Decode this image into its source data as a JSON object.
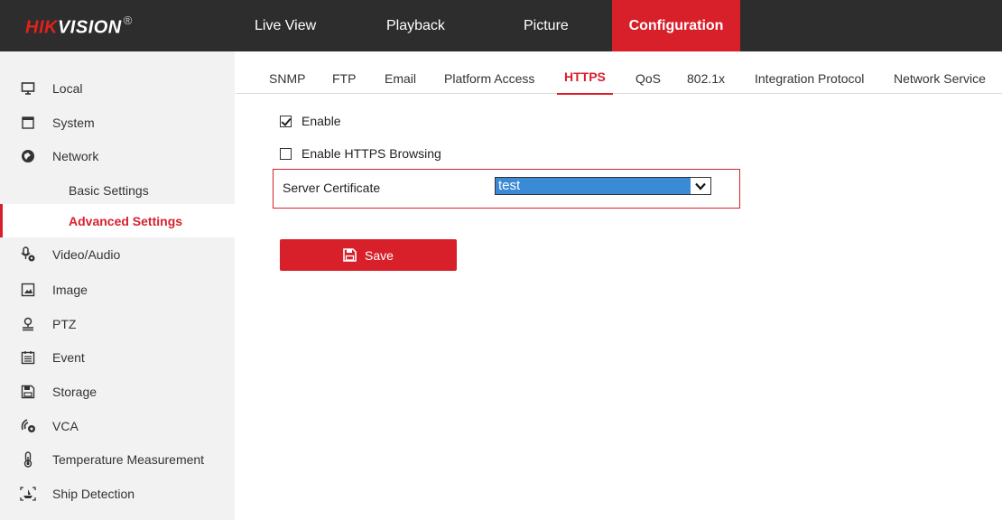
{
  "brand": {
    "prefix": "HIK",
    "suffix": "VISION",
    "mark": "®"
  },
  "nav": [
    {
      "label": "Live View"
    },
    {
      "label": "Playback"
    },
    {
      "label": "Picture"
    },
    {
      "label": "Configuration",
      "active": true
    }
  ],
  "sidebar": {
    "items": [
      {
        "label": "Local",
        "icon": "monitor-icon"
      },
      {
        "label": "System",
        "icon": "system-window-icon"
      },
      {
        "label": "Network",
        "icon": "network-globe-icon"
      },
      {
        "label": "Basic Settings",
        "sub": true
      },
      {
        "label": "Advanced Settings",
        "sub": true,
        "active": true
      },
      {
        "label": "Video/Audio",
        "icon": "video-audio-icon"
      },
      {
        "label": "Image",
        "icon": "image-icon"
      },
      {
        "label": "PTZ",
        "icon": "ptz-icon"
      },
      {
        "label": "Event",
        "icon": "event-calendar-icon"
      },
      {
        "label": "Storage",
        "icon": "storage-icon"
      },
      {
        "label": "VCA",
        "icon": "vca-icon"
      },
      {
        "label": "Temperature Measurement",
        "icon": "thermometer-icon"
      },
      {
        "label": "Ship Detection",
        "icon": "ship-detection-icon"
      }
    ]
  },
  "tabs": [
    {
      "label": "SNMP"
    },
    {
      "label": "FTP"
    },
    {
      "label": "Email"
    },
    {
      "label": "Platform Access"
    },
    {
      "label": "HTTPS",
      "active": true
    },
    {
      "label": "QoS"
    },
    {
      "label": "802.1x"
    },
    {
      "label": "Integration Protocol"
    },
    {
      "label": "Network Service"
    }
  ],
  "form": {
    "enable": {
      "label": "Enable",
      "checked": true
    },
    "https_browsing": {
      "label": "Enable HTTPS Browsing",
      "checked": false
    },
    "server_certificate": {
      "label": "Server Certificate",
      "value": "test"
    },
    "save_label": "Save"
  },
  "colors": {
    "accent": "#d8202b",
    "topbar": "#2d2d2d",
    "sidebar_bg": "#f2f2f2",
    "select_highlight": "#3a8ad6"
  }
}
